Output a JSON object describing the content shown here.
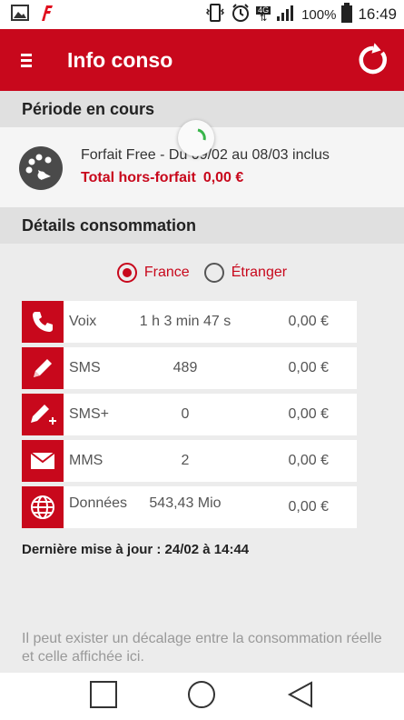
{
  "statusbar": {
    "network_badge": "4G",
    "battery_pct": "100%",
    "time": "16:49"
  },
  "appbar": {
    "title": "Info conso"
  },
  "period": {
    "header": "Période en cours",
    "forfait": "Forfait Free - Du 09/02 au 08/03 inclus",
    "hors_forfait_label": "Total hors-forfait",
    "hors_forfait_value": "0,00 €"
  },
  "details": {
    "header": "Détails consommation",
    "radio_france": "France",
    "radio_etranger": "Étranger",
    "selected": "France",
    "rows": [
      {
        "label": "Voix",
        "quantity": "1 h 3 min 47 s",
        "amount": "0,00 €",
        "icon": "phone-icon"
      },
      {
        "label": "SMS",
        "quantity": "489",
        "amount": "0,00 €",
        "icon": "pencil-icon"
      },
      {
        "label": "SMS+",
        "quantity": "0",
        "amount": "0,00 €",
        "icon": "pencil-plus-icon"
      },
      {
        "label": "MMS",
        "quantity": "2",
        "amount": "0,00 €",
        "icon": "envelope-icon"
      },
      {
        "label": "Données",
        "quantity": "543,43 Mio",
        "amount": "0,00 €",
        "icon": "globe-icon"
      }
    ],
    "last_update": "Dernière mise à jour : 24/02 à 14:44"
  },
  "notice": "Il peut exister un décalage entre la consommation réelle et celle affichée ici.",
  "colors": {
    "brand_red": "#c8081c"
  }
}
